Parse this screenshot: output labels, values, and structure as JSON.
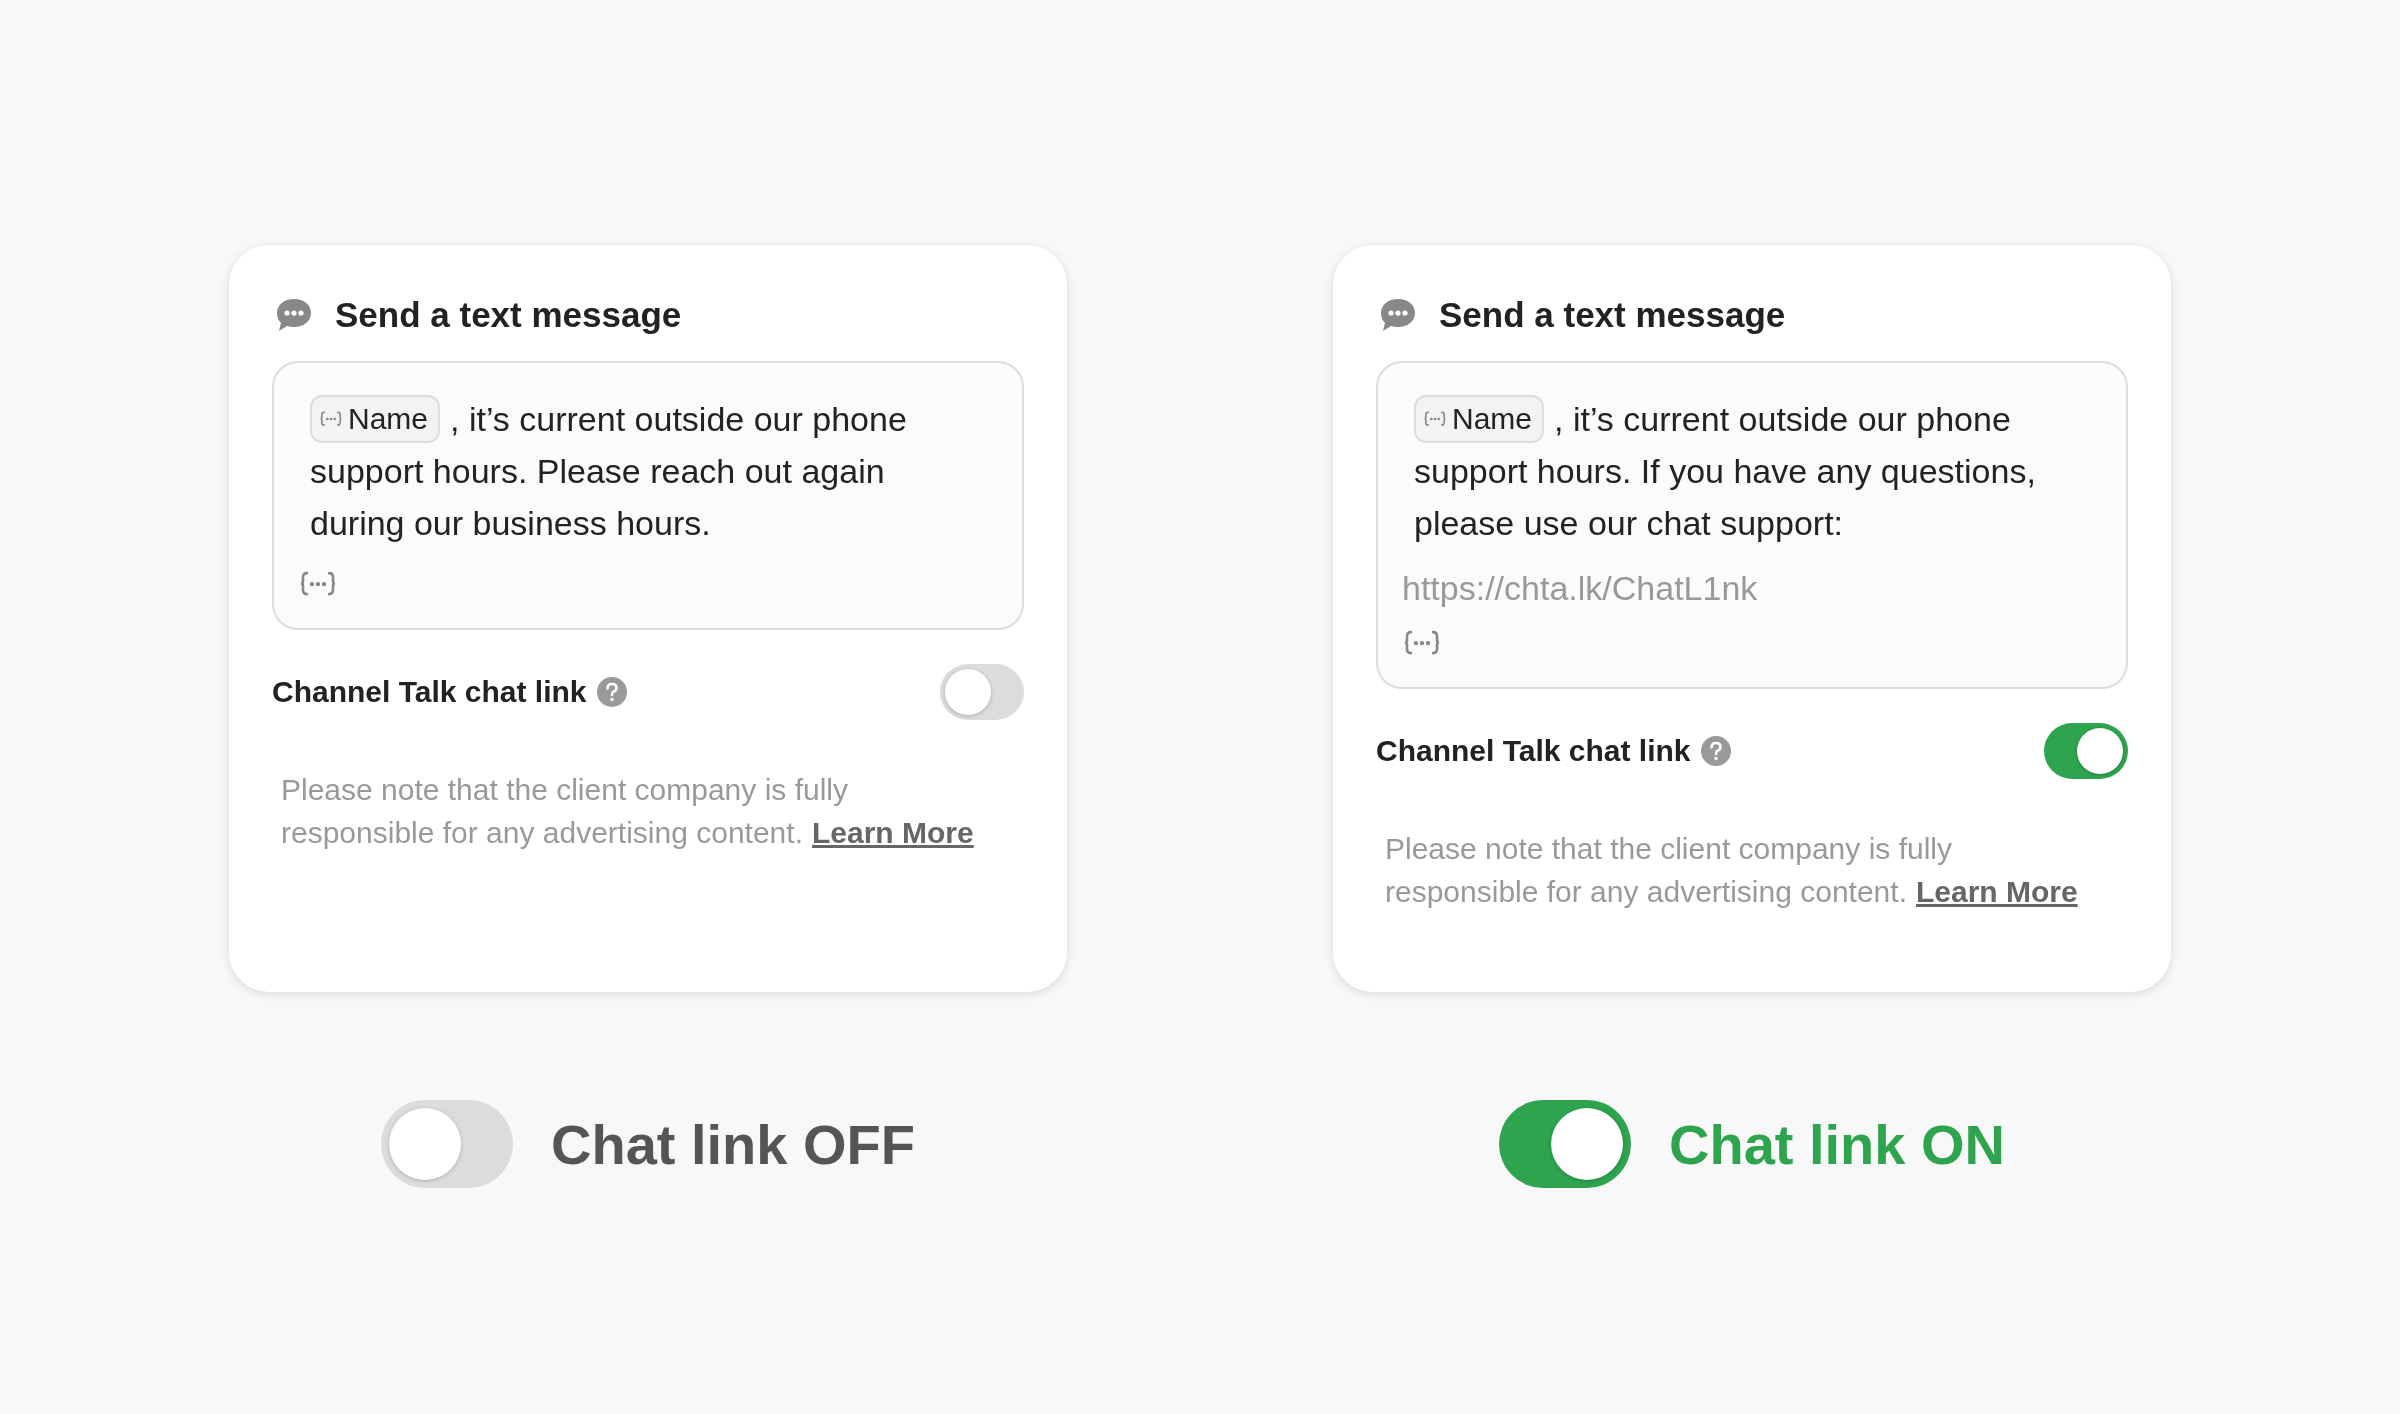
{
  "panels": [
    {
      "title": "Send a text message",
      "message": {
        "variable": "Name",
        "lines": [
          ", it’s current outside our phone",
          "support hours. Please reach out again",
          "during our business hours."
        ]
      },
      "chat_link": {
        "label": "Channel Talk chat link",
        "on": false
      },
      "note": {
        "lines": [
          "Please note that the client company is fully",
          "responsible for any advertising content."
        ],
        "link": "Learn More"
      },
      "caption": {
        "label": "Chat link OFF",
        "on": false
      }
    },
    {
      "title": "Send a text message",
      "message": {
        "variable": "Name",
        "lines": [
          ", it’s current outside our phone",
          "support hours. If you have any questions,",
          "please use our chat support:"
        ],
        "url": "https://chta.lk/ChatL1nk"
      },
      "chat_link": {
        "label": "Channel Talk chat link",
        "on": true
      },
      "note": {
        "lines": [
          "Please note that the client company is fully",
          "responsible for any advertising content."
        ],
        "link": "Learn More"
      },
      "caption": {
        "label": "Chat link ON",
        "on": true
      }
    }
  ]
}
